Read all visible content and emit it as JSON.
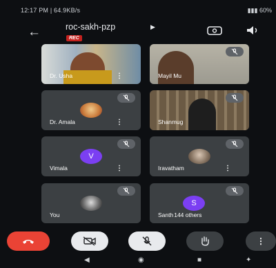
{
  "status": {
    "time_info": "12:17 PM | 64.9KB/s",
    "battery": "60%"
  },
  "meeting": {
    "code": "roc-sakh-pzp",
    "recording_badge": "REC"
  },
  "participants": [
    {
      "name": "Dr. Usha",
      "type": "video",
      "muted": false
    },
    {
      "name": "Mayil Mu",
      "type": "video",
      "muted": true
    },
    {
      "name": "Dr. Amala",
      "type": "avatar",
      "muted": true
    },
    {
      "name": "Shanmug",
      "type": "video",
      "muted": true
    },
    {
      "name": "Vimala",
      "type": "letter",
      "letter": "V",
      "muted": true
    },
    {
      "name": "Iravatham",
      "type": "avatar",
      "muted": true
    },
    {
      "name": "You",
      "type": "avatar",
      "muted": true
    },
    {
      "name": "Santh",
      "type": "letter",
      "letter": "S",
      "muted": true,
      "others": "144 others"
    }
  ],
  "controls": {
    "more": "⋮"
  },
  "colors": {
    "end_call": "#ea4335",
    "avatar_purple": "#7b3ff2",
    "tile": "#3c4043",
    "rec": "#c5221f"
  }
}
